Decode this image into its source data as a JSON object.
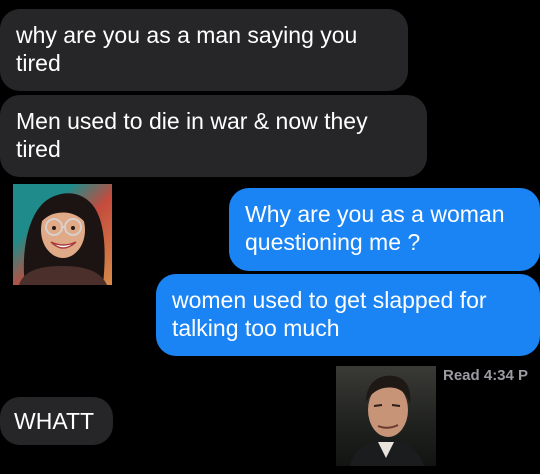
{
  "messages": [
    {
      "id": "m1",
      "direction": "incoming",
      "text_line1": "why are you as a man saying you",
      "text_line2": "tired"
    },
    {
      "id": "m2",
      "direction": "incoming",
      "text_line1": "Men used to die in war & now they",
      "text_line2": "tired"
    },
    {
      "id": "m3",
      "direction": "outgoing",
      "text_line1": "Why are you as a woman",
      "text_line2": "questioning me ?"
    },
    {
      "id": "m4",
      "direction": "outgoing",
      "text_line1": "women used to get slapped for",
      "text_line2": "talking too much"
    },
    {
      "id": "m5",
      "direction": "incoming",
      "text_line1": "WHATT"
    }
  ],
  "read_receipt": "Read 4:34 P",
  "colors": {
    "background": "#000000",
    "incoming_bubble": "#262628",
    "outgoing_bubble": "#1a84f5",
    "read_receipt": "#9b9ba1"
  }
}
